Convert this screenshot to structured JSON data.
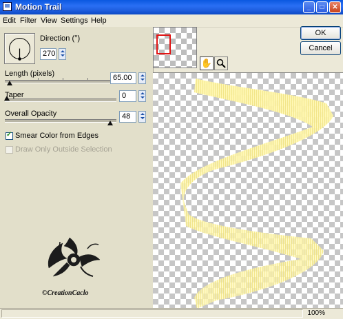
{
  "window": {
    "title": "Motion Trail"
  },
  "menu": [
    "Edit",
    "Filter",
    "View",
    "Settings",
    "Help"
  ],
  "direction": {
    "label": "Direction (°)",
    "value": "270"
  },
  "length": {
    "label": "Length (pixels)",
    "value": "65.00"
  },
  "taper": {
    "label": "Taper",
    "value": "0"
  },
  "opacity": {
    "label": "Overall Opacity",
    "value": "48"
  },
  "options": {
    "smear_label": "Smear Color from Edges",
    "smear_checked": true,
    "draw_outside_label": "Draw Only Outside Selection",
    "draw_outside_enabled": false
  },
  "watermark": {
    "text": "©CreationCaclo"
  },
  "buttons": {
    "ok": "OK",
    "cancel": "Cancel"
  },
  "tools": {
    "pan": "pan-hand-icon",
    "zoom": "magnifier-icon"
  },
  "status": {
    "zoom": "100%"
  },
  "colors": {
    "title_bar": "#0a58e0",
    "trail": "#fff5a8",
    "panel": "#e2dfca"
  }
}
